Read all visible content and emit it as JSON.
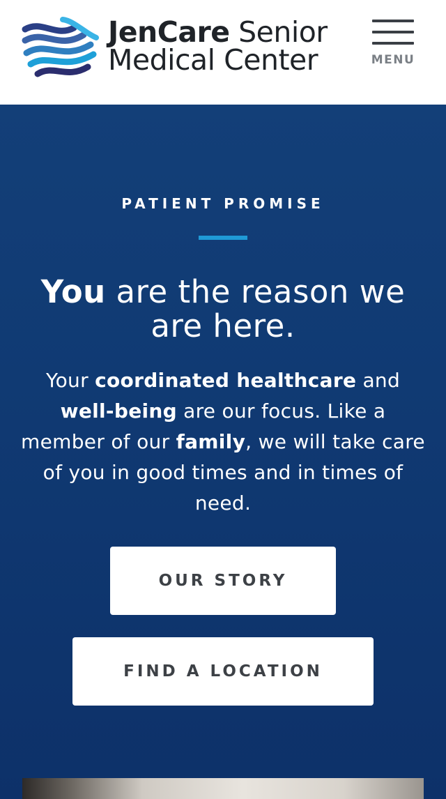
{
  "header": {
    "brand_bold": "JenCare",
    "brand_thin": "Senior",
    "brand_line2": "Medical Center",
    "menu_label": "MENU",
    "logo_icon": "wave-stripes-logo-icon",
    "menu_icon": "hamburger-icon"
  },
  "hero": {
    "eyebrow": "PATIENT PROMISE",
    "headline_em": "You",
    "headline_rest": "are the reason we are here.",
    "body": {
      "part1": "Your",
      "strong1": "coordinated healthcare",
      "part2": "and",
      "strong2": "well-being",
      "part3": "are our focus. Like a member of our",
      "strong3": "family",
      "part4": ", we will take care of you in good times and in times of need."
    },
    "buttons": {
      "story": "OUR STORY",
      "location": "FIND A LOCATION"
    }
  },
  "colors": {
    "hero_bg": "#123d76",
    "accent_rule": "#1f9ad6",
    "button_bg": "#ffffff",
    "button_text": "#3d4146",
    "brand_text": "#1f2328"
  }
}
